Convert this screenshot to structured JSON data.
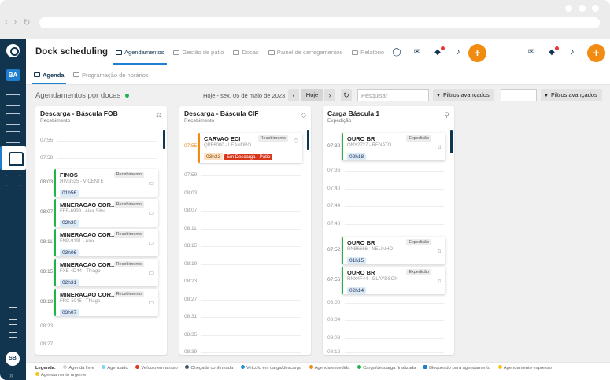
{
  "app": {
    "title": "Dock scheduling",
    "user_initials": "BA",
    "bottom_initials": "SB"
  },
  "colors": {
    "sidebar": "#11354f",
    "accent": "#1f7ed0",
    "orange": "#f28b12",
    "green": "#20b34a",
    "red": "#d9361b"
  },
  "tabs": [
    {
      "label": "Agendamentos",
      "icon": "calendar-icon",
      "active": true
    },
    {
      "label": "Gestão de pátio",
      "icon": "yard-icon"
    },
    {
      "label": "Docas",
      "icon": "truck-icon"
    },
    {
      "label": "Painel de carregamentos",
      "icon": "chart-icon"
    },
    {
      "label": "Relatório",
      "icon": "report-icon"
    }
  ],
  "subtabs": [
    {
      "label": "Agenda",
      "icon": "calendar-icon",
      "active": true
    },
    {
      "label": "Programação de horários",
      "icon": "list-icon"
    }
  ],
  "board": {
    "title": "Agendamentos por docas",
    "date": "Hoje - sex, 05 de maio de 2023",
    "today_label": "Hoje",
    "search_placeholder": "Pesquisar",
    "filter_label": "Filtros avançados"
  },
  "columns": [
    {
      "title": "Descarga - Báscula FOB",
      "subtitle": "Recebimento",
      "slots_before": [
        "07:55",
        "07:58"
      ],
      "cards": [
        {
          "time": "08:03",
          "name": "FINOS",
          "plate": "HIM3535 - VICENTE",
          "duration": "01h56",
          "tag": "Recebimento"
        },
        {
          "time": "08:07",
          "name": "MINERACAO COR...",
          "plate": "FEB-6999 - Alex Silva",
          "duration": "02h30",
          "tag": "Recebimento"
        },
        {
          "time": "08:11",
          "name": "MINERACAO COR...",
          "plate": "FNP-9191 - Alex",
          "duration": "03h06",
          "tag": "Recebimento"
        },
        {
          "time": "08:15",
          "name": "MINERACAO COR...",
          "plate": "FXE-4D44 - Thiago",
          "duration": "02h31",
          "tag": "Recebimento"
        },
        {
          "time": "08:19",
          "name": "MINERACAO COR...",
          "plate": "FRC-5045 - Thiago",
          "duration": "03h07",
          "tag": "Recebimento"
        }
      ],
      "slots_after": [
        "08:23",
        "08:27"
      ]
    },
    {
      "title": "Descarga - Báscula CIF",
      "subtitle": "Recebimento",
      "card": {
        "time": "07:55",
        "name": "CARVAO ECI",
        "plate": "QPF6000 - LEANDRO",
        "duration": "03h33",
        "tag": "Recebimento",
        "status": "Em Descarga - Pátio"
      },
      "slots": [
        "07:59",
        "08:03",
        "08:07",
        "08:11",
        "08:15",
        "08:19",
        "08:23",
        "08:27",
        "08:31",
        "08:35",
        "08:39",
        "08:43"
      ]
    },
    {
      "title": "Carga Báscula 1",
      "subtitle": "Expedição",
      "cards": [
        {
          "time": "07:32",
          "name": "OURO BR",
          "plate": "QNY2727 - RENATO",
          "duration": "02h18",
          "tag": "Expedição"
        },
        {
          "time": "07:52",
          "name": "OURO BR",
          "plate": "RNB6666 - NELINHO",
          "duration": "01h15",
          "tag": "Expedição"
        },
        {
          "time": "07:56",
          "name": "OURO BR",
          "plate": "RNX4F44 - GLAYDSON",
          "duration": "02h14",
          "tag": "Expedição"
        }
      ],
      "slots_a": [
        "07:36",
        "07:40",
        "07:44",
        "07:48"
      ],
      "slots_b": [
        "08:00",
        "08:04",
        "08:08",
        "08:12"
      ]
    }
  ],
  "legend": {
    "label": "Legenda:",
    "items": [
      {
        "label": "Agenda livre",
        "color": "#d4d4d4"
      },
      {
        "label": "Agendado",
        "color": "#7fd6f0"
      },
      {
        "label": "Veículo em atraso",
        "color": "#d9361b"
      },
      {
        "label": "Chegada confirmada",
        "color": "#3c5566"
      },
      {
        "label": "Veículo em carga/descarga",
        "color": "#1f8fe0"
      },
      {
        "label": "Agenda excedida",
        "color": "#f28b12"
      },
      {
        "label": "Carga/descarga finalizada",
        "color": "#20b34a"
      },
      {
        "label": "Bloqueado para agendamento",
        "color": "#1f7ed0"
      },
      {
        "label": "Agendamento expresso",
        "color": "#f5c518"
      },
      {
        "label": "Agendamento urgente",
        "color": "#f5c518"
      }
    ]
  }
}
